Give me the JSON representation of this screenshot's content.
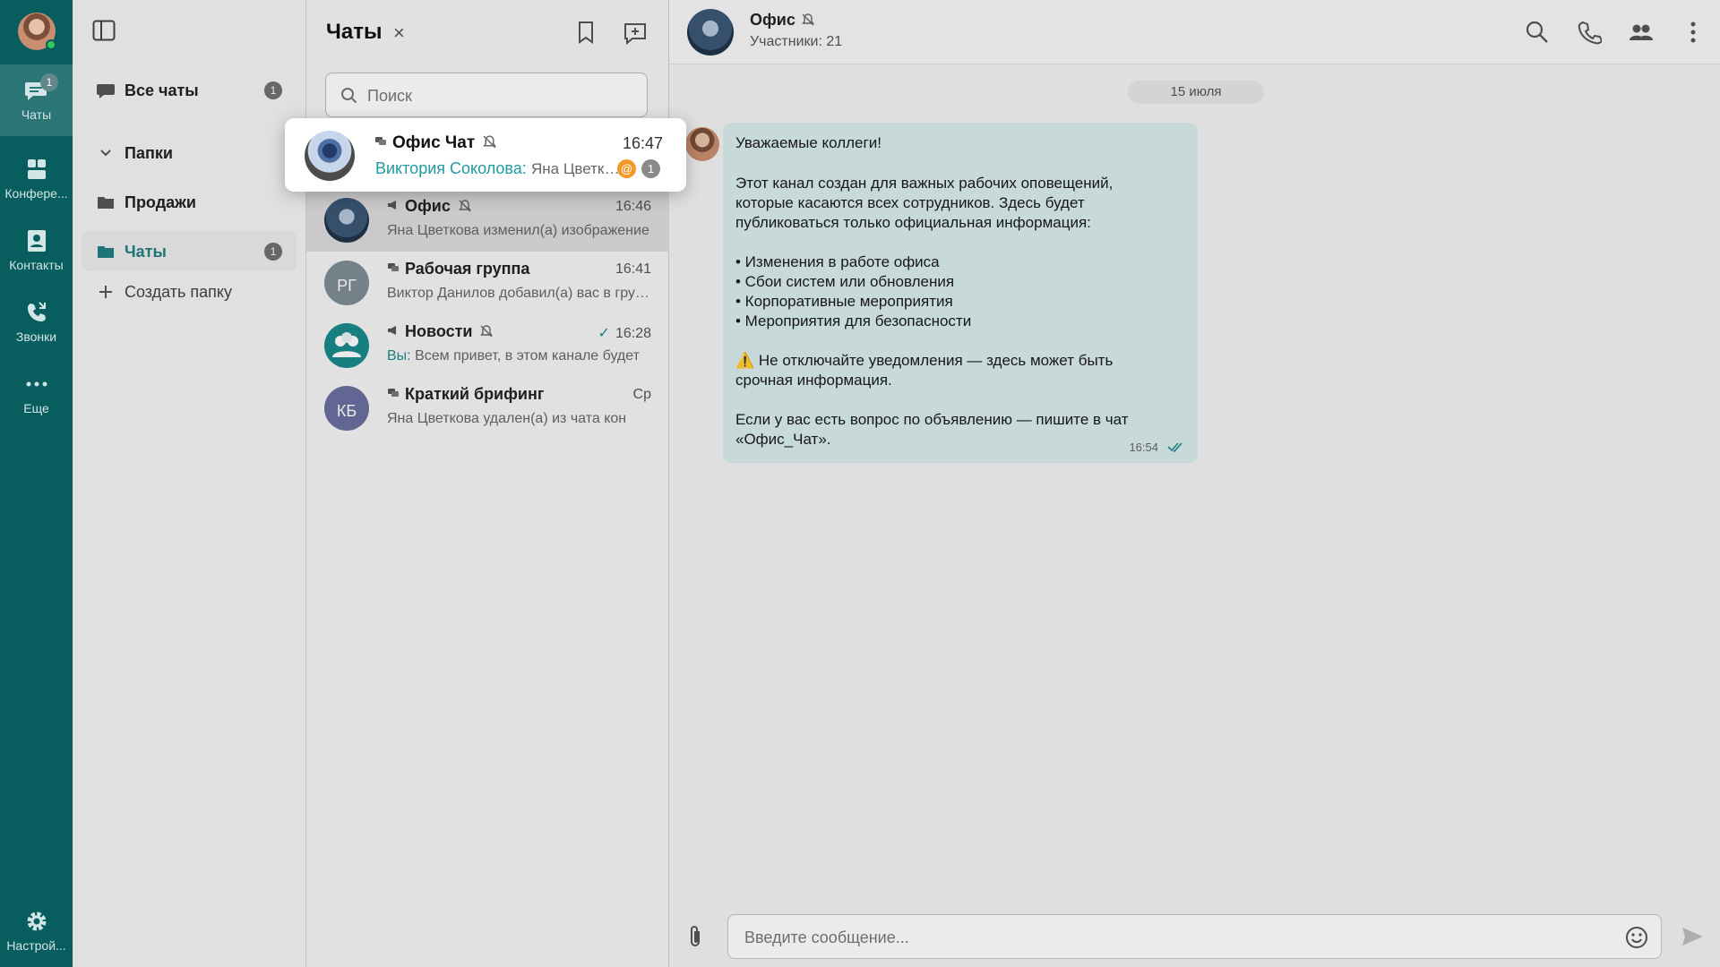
{
  "colors": {
    "rail": "#085d5f",
    "accent": "#1f8a91",
    "mention": "#f39a2b",
    "bubble": "#d8ecec"
  },
  "rail": {
    "badge": "1",
    "items": [
      {
        "label": "Чаты",
        "icon": "chat-icon"
      },
      {
        "label": "Конфере...",
        "icon": "conference-icon"
      },
      {
        "label": "Контакты",
        "icon": "contacts-icon"
      },
      {
        "label": "Звонки",
        "icon": "calls-icon"
      },
      {
        "label": "Еще",
        "icon": "more-icon"
      },
      {
        "label": "Настрой...",
        "icon": "gear-icon"
      }
    ]
  },
  "folders": {
    "all_chats": "Все чаты",
    "all_chats_badge": "1",
    "folders_label": "Папки",
    "sales": "Продажи",
    "chats": "Чаты",
    "chats_badge": "1",
    "create": "Создать папку"
  },
  "chatlist": {
    "title": "Чаты",
    "close": "×",
    "search_placeholder": "Поиск",
    "popup": {
      "title": "Офис Чат",
      "time": "16:47",
      "sender": "Виктория Соколова:",
      "text": "Яна Цветкова",
      "mention": "@",
      "unread": "1"
    },
    "rows": [
      {
        "title": "Офис",
        "time": "16:46",
        "preview": "Яна Цветкова изменил(а) изображение"
      },
      {
        "title": "Рабочая группа",
        "initials": "РГ",
        "time": "16:41",
        "preview": "Виктор Данилов добавил(а) вас в группу"
      },
      {
        "title": "Новости",
        "time": "16:28",
        "you": "Вы:",
        "preview": "Всем привет, в этом канале будет"
      },
      {
        "title": "Краткий брифинг",
        "initials": "КБ",
        "time": "Ср",
        "preview": "Яна Цветкова удален(а) из чата кон"
      }
    ]
  },
  "conversation": {
    "name": "Офис",
    "subtitle": "Участники: 21",
    "date": "15 июля",
    "message": {
      "lines": [
        "Уважаемые коллеги!",
        "Этот канал создан для важных рабочих оповещений,",
        "которые касаются всех сотрудников. Здесь будет",
        "публиковаться только официальная информация:",
        "• Изменения в работе офиса",
        "• Сбои систем или обновления",
        "• Корпоративные мероприятия",
        "• Мероприятия для безопасности",
        "⚠️ Не отключайте уведомления — здесь может быть",
        "срочная информация.",
        "Если у вас есть вопрос по объявлению — пишите в чат",
        "«Офис_Чат»."
      ],
      "time": "16:54"
    },
    "composer_placeholder": "Введите сообщение..."
  }
}
